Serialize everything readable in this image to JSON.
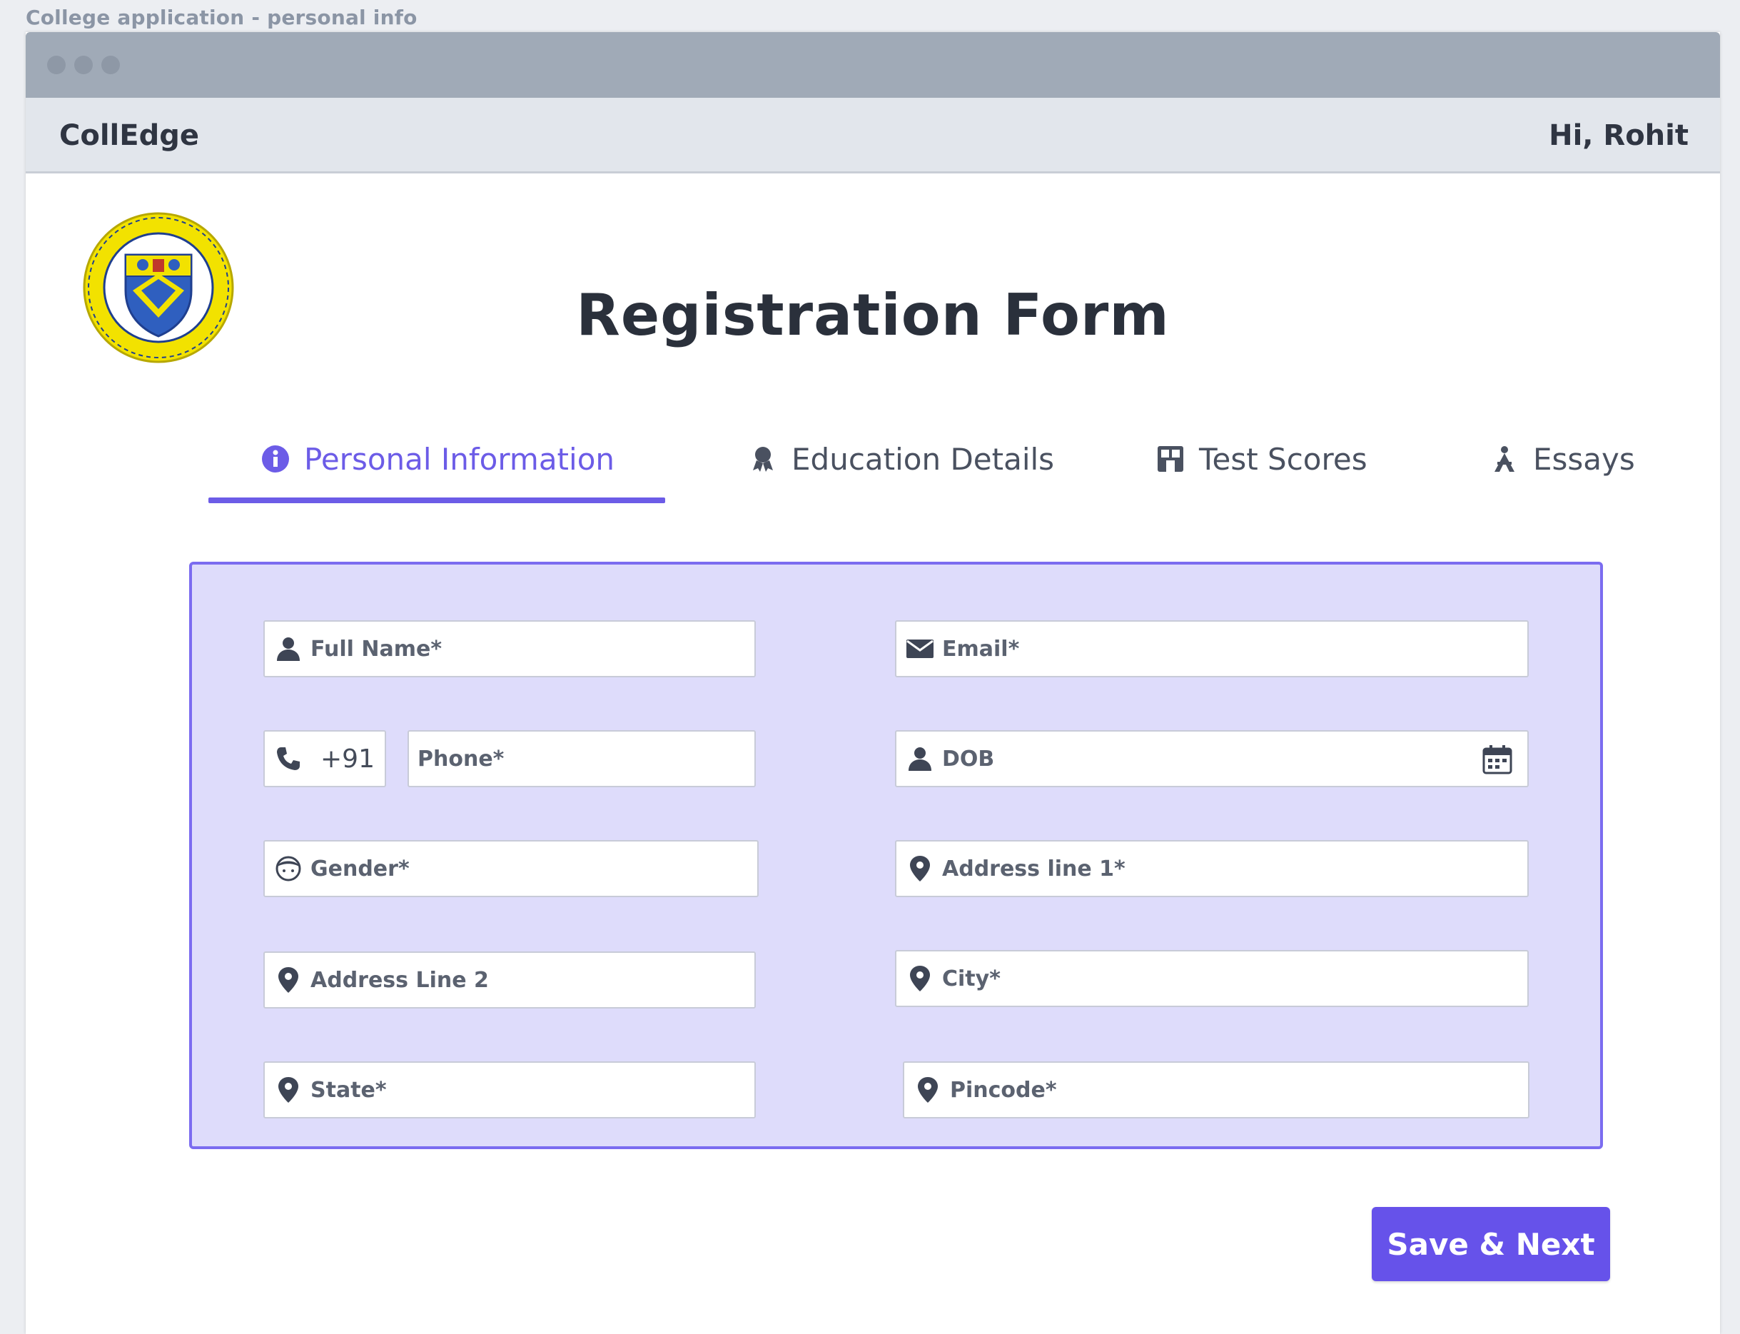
{
  "frame": {
    "caption": "College application - personal info"
  },
  "app": {
    "brand": "CollEdge",
    "greeting": "Hi, Rohit"
  },
  "page": {
    "title": "Registration Form",
    "logo_icon": "university-seal"
  },
  "tabs": [
    {
      "label": "Personal Information",
      "icon": "info-circle-icon",
      "active": true
    },
    {
      "label": "Education Details",
      "icon": "award-icon",
      "active": false
    },
    {
      "label": "Test Scores",
      "icon": "scores-icon",
      "active": false
    },
    {
      "label": "Essays",
      "icon": "essay-icon",
      "active": false
    }
  ],
  "form": {
    "full_name": {
      "placeholder": "Full Name*",
      "icon": "user-icon"
    },
    "email": {
      "placeholder": "Email*",
      "icon": "mail-icon"
    },
    "country_code": {
      "value": "+91",
      "icon": "phone-icon"
    },
    "phone": {
      "placeholder": "Phone*"
    },
    "dob": {
      "placeholder": "DOB",
      "icon": "user-icon",
      "trailing_icon": "calendar-icon"
    },
    "gender": {
      "placeholder": "Gender*",
      "icon": "face-icon"
    },
    "address_line_1": {
      "placeholder": "Address line 1*",
      "icon": "location-pin-icon"
    },
    "address_line_2": {
      "placeholder": "Address Line 2",
      "icon": "location-pin-icon"
    },
    "city": {
      "placeholder": "City*",
      "icon": "location-pin-icon"
    },
    "state": {
      "placeholder": "State*",
      "icon": "location-pin-icon"
    },
    "pincode": {
      "placeholder": "Pincode*",
      "icon": "location-pin-icon"
    }
  },
  "actions": {
    "save_next": "Save & Next"
  },
  "colors": {
    "accent": "#6c5ce7",
    "panel_bg": "#dedcfb",
    "titlebar": "#a0aab7"
  }
}
